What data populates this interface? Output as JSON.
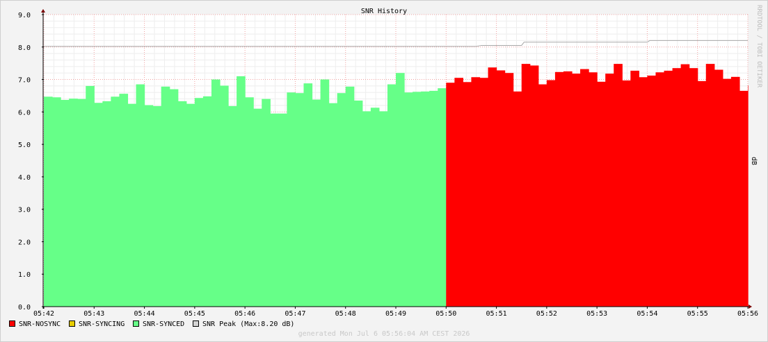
{
  "chart_data": {
    "type": "area",
    "title": "SNR History",
    "ylabel": "dB",
    "watermark": "RRDTOOL / TOBI OETIKER",
    "footer": "generated Mon Jul  6 05:56:04 AM CEST 2026",
    "ylim": [
      0,
      9
    ],
    "yticks": [
      "0.0",
      "1.0",
      "2.0",
      "3.0",
      "4.0",
      "5.0",
      "6.0",
      "7.0",
      "8.0",
      "9.0"
    ],
    "xticks": [
      "05:42",
      "05:43",
      "05:44",
      "05:45",
      "05:46",
      "05:47",
      "05:48",
      "05:49",
      "05:50",
      "05:51",
      "05:52",
      "05:53",
      "05:54",
      "05:55",
      "05:56"
    ],
    "grid": true,
    "legend_position": "bottom-left",
    "legend": [
      {
        "label": "SNR-NOSYNC",
        "color": "#ff0000"
      },
      {
        "label": "SNR-SYNCING",
        "color": "#e6cc00"
      },
      {
        "label": "SNR-SYNCED",
        "color": "#66ff88"
      },
      {
        "label": "SNR Peak  (Max:8.20 dB)",
        "color": "#d4d4d4"
      }
    ],
    "samples_per_minute": 6,
    "series": [
      {
        "name": "SNR-SYNCED",
        "color": "#66ff88",
        "start_minute": 0,
        "values": [
          6.47,
          6.45,
          6.37,
          6.41,
          6.4,
          6.8,
          6.28,
          6.33,
          6.47,
          6.56,
          6.25,
          6.85,
          6.21,
          6.18,
          6.78,
          6.7,
          6.33,
          6.25,
          6.43,
          6.48,
          7.0,
          6.81,
          6.18,
          7.1,
          6.45,
          6.1,
          6.4,
          5.95,
          5.95,
          6.6,
          6.58,
          6.88,
          6.38,
          7.0,
          6.27,
          6.58,
          6.78,
          6.35,
          6.02,
          6.13,
          6.02,
          6.85,
          7.2,
          6.6,
          6.62,
          6.63,
          6.65,
          6.73
        ]
      },
      {
        "name": "SNR-NOSYNC",
        "color": "#ff0000",
        "start_minute": 8,
        "values": [
          6.9,
          7.05,
          6.92,
          7.07,
          7.05,
          7.37,
          7.28,
          7.2,
          6.63,
          7.48,
          7.43,
          6.85,
          6.98,
          7.23,
          7.25,
          7.18,
          7.32,
          7.22,
          6.93,
          7.18,
          7.48,
          6.97,
          7.27,
          7.07,
          7.12,
          7.22,
          7.27,
          7.35,
          7.47,
          7.35,
          6.95,
          7.48,
          7.3,
          7.02,
          7.08,
          6.65,
          6.82
        ]
      }
    ],
    "peak": {
      "name": "SNR Peak",
      "color": "#a8a8a8",
      "steps": [
        {
          "x": 0,
          "y": 8.02
        },
        {
          "x": 8.6,
          "y": 8.02
        },
        {
          "x": 8.7,
          "y": 8.05
        },
        {
          "x": 9.5,
          "y": 8.05
        },
        {
          "x": 9.55,
          "y": 8.15
        },
        {
          "x": 12.0,
          "y": 8.15
        },
        {
          "x": 12.05,
          "y": 8.2
        },
        {
          "x": 14.0,
          "y": 8.2
        }
      ]
    }
  }
}
